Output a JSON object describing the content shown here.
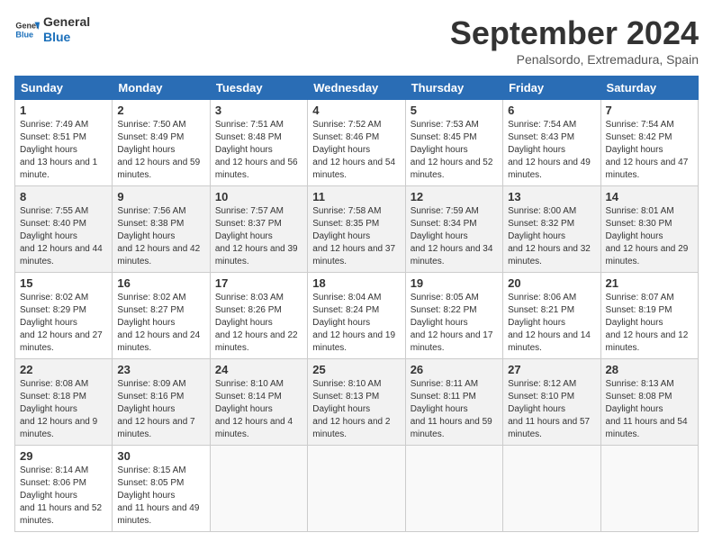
{
  "header": {
    "logo_line1": "General",
    "logo_line2": "Blue",
    "month": "September 2024",
    "location": "Penalsordo, Extremadura, Spain"
  },
  "weekdays": [
    "Sunday",
    "Monday",
    "Tuesday",
    "Wednesday",
    "Thursday",
    "Friday",
    "Saturday"
  ],
  "weeks": [
    [
      {
        "day": "1",
        "sunrise": "7:49 AM",
        "sunset": "8:51 PM",
        "daylight": "13 hours and 1 minute."
      },
      {
        "day": "2",
        "sunrise": "7:50 AM",
        "sunset": "8:49 PM",
        "daylight": "12 hours and 59 minutes."
      },
      {
        "day": "3",
        "sunrise": "7:51 AM",
        "sunset": "8:48 PM",
        "daylight": "12 hours and 56 minutes."
      },
      {
        "day": "4",
        "sunrise": "7:52 AM",
        "sunset": "8:46 PM",
        "daylight": "12 hours and 54 minutes."
      },
      {
        "day": "5",
        "sunrise": "7:53 AM",
        "sunset": "8:45 PM",
        "daylight": "12 hours and 52 minutes."
      },
      {
        "day": "6",
        "sunrise": "7:54 AM",
        "sunset": "8:43 PM",
        "daylight": "12 hours and 49 minutes."
      },
      {
        "day": "7",
        "sunrise": "7:54 AM",
        "sunset": "8:42 PM",
        "daylight": "12 hours and 47 minutes."
      }
    ],
    [
      {
        "day": "8",
        "sunrise": "7:55 AM",
        "sunset": "8:40 PM",
        "daylight": "12 hours and 44 minutes."
      },
      {
        "day": "9",
        "sunrise": "7:56 AM",
        "sunset": "8:38 PM",
        "daylight": "12 hours and 42 minutes."
      },
      {
        "day": "10",
        "sunrise": "7:57 AM",
        "sunset": "8:37 PM",
        "daylight": "12 hours and 39 minutes."
      },
      {
        "day": "11",
        "sunrise": "7:58 AM",
        "sunset": "8:35 PM",
        "daylight": "12 hours and 37 minutes."
      },
      {
        "day": "12",
        "sunrise": "7:59 AM",
        "sunset": "8:34 PM",
        "daylight": "12 hours and 34 minutes."
      },
      {
        "day": "13",
        "sunrise": "8:00 AM",
        "sunset": "8:32 PM",
        "daylight": "12 hours and 32 minutes."
      },
      {
        "day": "14",
        "sunrise": "8:01 AM",
        "sunset": "8:30 PM",
        "daylight": "12 hours and 29 minutes."
      }
    ],
    [
      {
        "day": "15",
        "sunrise": "8:02 AM",
        "sunset": "8:29 PM",
        "daylight": "12 hours and 27 minutes."
      },
      {
        "day": "16",
        "sunrise": "8:02 AM",
        "sunset": "8:27 PM",
        "daylight": "12 hours and 24 minutes."
      },
      {
        "day": "17",
        "sunrise": "8:03 AM",
        "sunset": "8:26 PM",
        "daylight": "12 hours and 22 minutes."
      },
      {
        "day": "18",
        "sunrise": "8:04 AM",
        "sunset": "8:24 PM",
        "daylight": "12 hours and 19 minutes."
      },
      {
        "day": "19",
        "sunrise": "8:05 AM",
        "sunset": "8:22 PM",
        "daylight": "12 hours and 17 minutes."
      },
      {
        "day": "20",
        "sunrise": "8:06 AM",
        "sunset": "8:21 PM",
        "daylight": "12 hours and 14 minutes."
      },
      {
        "day": "21",
        "sunrise": "8:07 AM",
        "sunset": "8:19 PM",
        "daylight": "12 hours and 12 minutes."
      }
    ],
    [
      {
        "day": "22",
        "sunrise": "8:08 AM",
        "sunset": "8:18 PM",
        "daylight": "12 hours and 9 minutes."
      },
      {
        "day": "23",
        "sunrise": "8:09 AM",
        "sunset": "8:16 PM",
        "daylight": "12 hours and 7 minutes."
      },
      {
        "day": "24",
        "sunrise": "8:10 AM",
        "sunset": "8:14 PM",
        "daylight": "12 hours and 4 minutes."
      },
      {
        "day": "25",
        "sunrise": "8:10 AM",
        "sunset": "8:13 PM",
        "daylight": "12 hours and 2 minutes."
      },
      {
        "day": "26",
        "sunrise": "8:11 AM",
        "sunset": "8:11 PM",
        "daylight": "11 hours and 59 minutes."
      },
      {
        "day": "27",
        "sunrise": "8:12 AM",
        "sunset": "8:10 PM",
        "daylight": "11 hours and 57 minutes."
      },
      {
        "day": "28",
        "sunrise": "8:13 AM",
        "sunset": "8:08 PM",
        "daylight": "11 hours and 54 minutes."
      }
    ],
    [
      {
        "day": "29",
        "sunrise": "8:14 AM",
        "sunset": "8:06 PM",
        "daylight": "11 hours and 52 minutes."
      },
      {
        "day": "30",
        "sunrise": "8:15 AM",
        "sunset": "8:05 PM",
        "daylight": "11 hours and 49 minutes."
      },
      null,
      null,
      null,
      null,
      null
    ]
  ]
}
